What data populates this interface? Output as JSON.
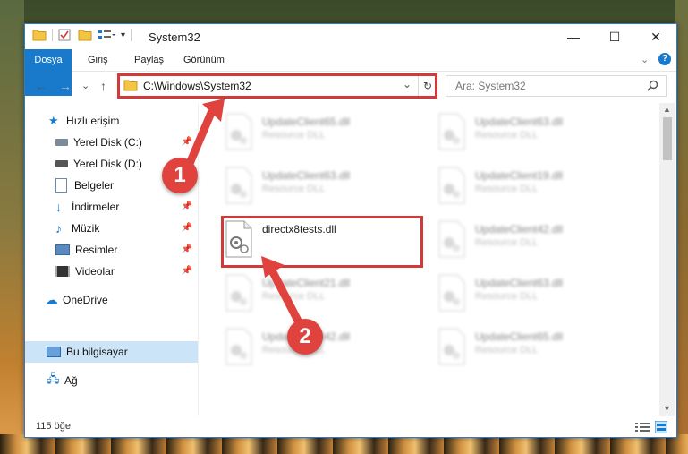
{
  "window": {
    "title": "System32",
    "minimize": "—",
    "maximize": "☐",
    "close": "✕"
  },
  "ribbon": {
    "tabs": [
      "Dosya",
      "Giriş",
      "Paylaş",
      "Görünüm"
    ]
  },
  "nav": {
    "back": "←",
    "forward": "→",
    "recent": "⌄",
    "up": "↑",
    "address": "C:\\Windows\\System32",
    "search_placeholder": "Ara: System32"
  },
  "sidebar": {
    "items": [
      {
        "label": "Hızlı erişim",
        "icon": "star-icon"
      },
      {
        "label": "Yerel Disk (C:)",
        "icon": "drive-icon",
        "pinned": true
      },
      {
        "label": "Yerel Disk (D:)",
        "icon": "drive-icon",
        "pinned": true
      },
      {
        "label": "Belgeler",
        "icon": "documents-icon",
        "pinned": true
      },
      {
        "label": "İndirmeler",
        "icon": "download-icon",
        "pinned": true
      },
      {
        "label": "Müzik",
        "icon": "music-icon",
        "pinned": true
      },
      {
        "label": "Resimler",
        "icon": "pictures-icon",
        "pinned": true
      },
      {
        "label": "Videolar",
        "icon": "video-icon",
        "pinned": true
      },
      {
        "label": "OneDrive",
        "icon": "cloud-icon"
      },
      {
        "label": "Bu bilgisayar",
        "icon": "computer-icon",
        "selected": true
      },
      {
        "label": "Ağ",
        "icon": "network-icon"
      }
    ]
  },
  "files": {
    "left": [
      {
        "name": "UpdateClient65.dll",
        "type": "Resource DLL"
      },
      {
        "name": "UpdateClient63.dll",
        "type": "Resource DLL"
      },
      {
        "name": "directx8tests.dll",
        "type": ""
      },
      {
        "name": "UpdateClient21.dll",
        "type": "Resource DLL"
      },
      {
        "name": "UpdateClient42.dll",
        "type": "Resource DLL"
      }
    ],
    "right": [
      {
        "name": "UpdateClient63.dll",
        "type": "Resource DLL"
      },
      {
        "name": "UpdateClient19.dll",
        "type": "Resource DLL"
      },
      {
        "name": "UpdateClient42.dll",
        "type": "Resource DLL"
      },
      {
        "name": "UpdateClient63.dll",
        "type": "Resource DLL"
      },
      {
        "name": "UpdateClient65.dll",
        "type": "Resource DLL"
      }
    ]
  },
  "status": {
    "count": "115 öğe"
  },
  "badges": [
    "1",
    "2"
  ],
  "colors": {
    "accent": "#1979ca",
    "highlight": "#d23a3a",
    "selected": "#cce4f7"
  }
}
